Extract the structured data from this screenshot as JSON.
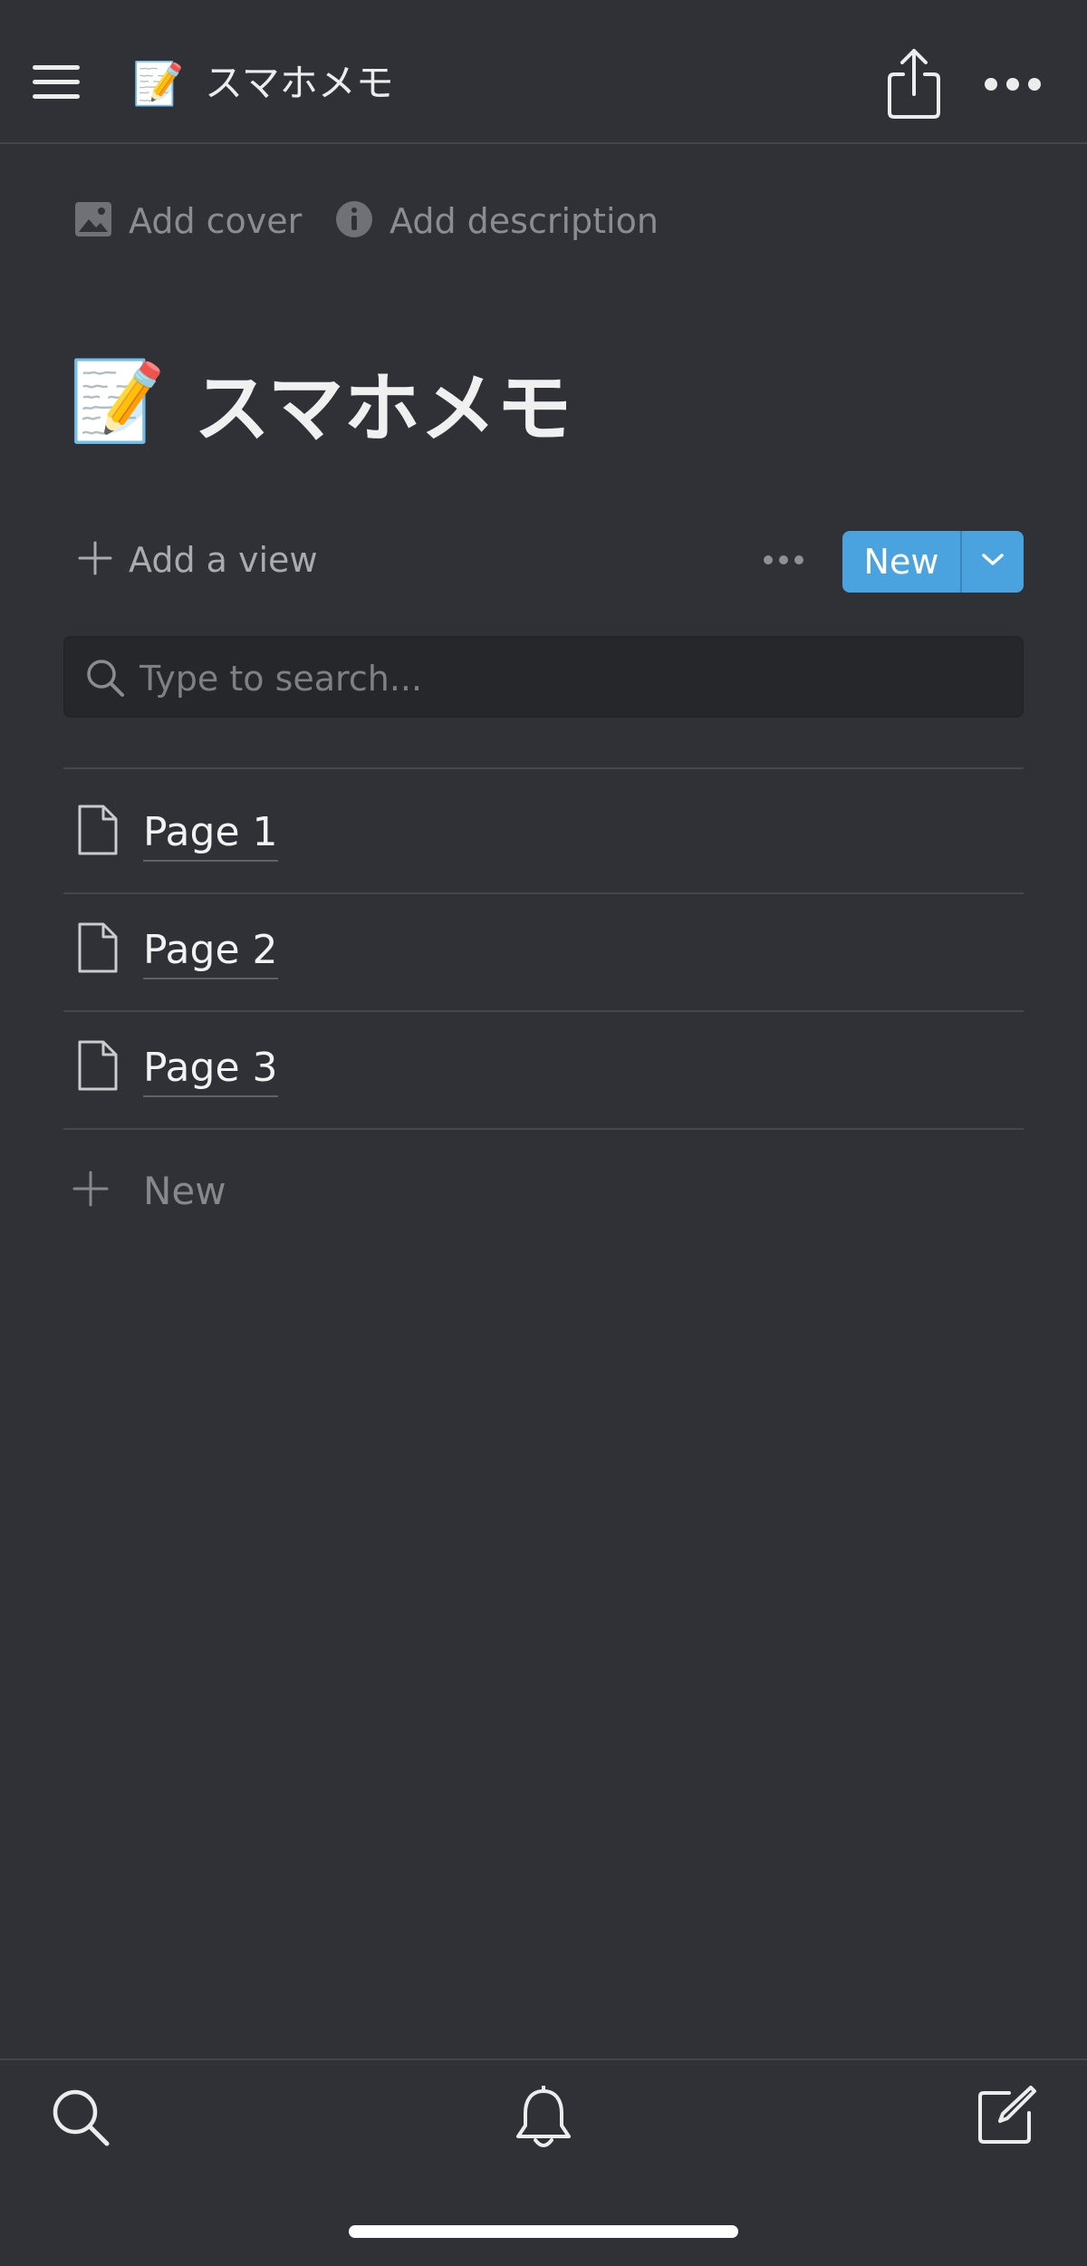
{
  "topbar": {
    "emoji": "📝",
    "title": "スマホメモ",
    "share_icon": "share-icon",
    "more_icon": "more-horizontal-icon"
  },
  "page": {
    "add_cover_label": "Add cover",
    "add_description_label": "Add description",
    "emoji": "📝",
    "title": "スマホメモ"
  },
  "view_toolbar": {
    "add_view_label": "Add a view",
    "new_button_label": "New"
  },
  "search": {
    "placeholder": "Type to search..."
  },
  "list": {
    "items": [
      {
        "label": "Page 1"
      },
      {
        "label": "Page 2"
      },
      {
        "label": "Page 3"
      }
    ],
    "add_label": "New"
  },
  "bottombar": {
    "icons": [
      "search-icon",
      "bell-icon",
      "compose-icon"
    ]
  },
  "colors": {
    "background": "#2f3136",
    "accent": "#4aa3df",
    "divider": "#45474c"
  }
}
